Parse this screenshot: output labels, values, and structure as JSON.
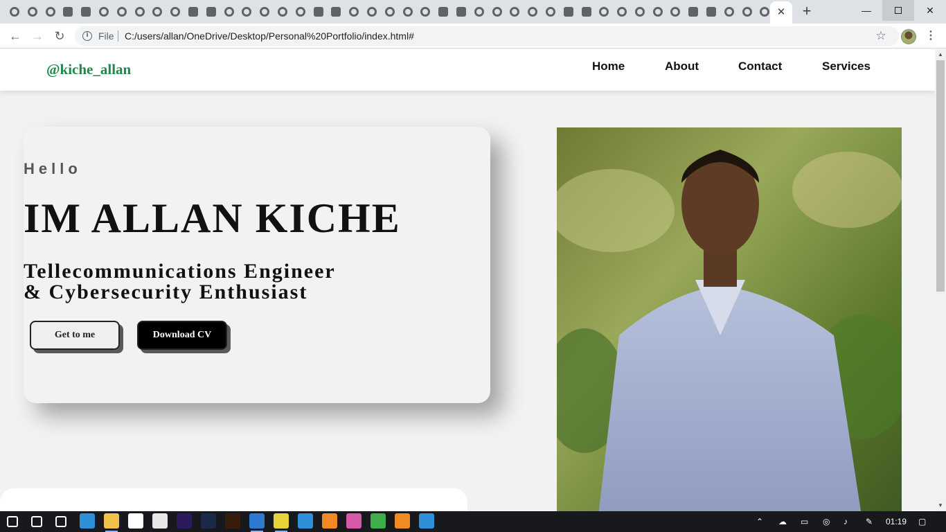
{
  "browser": {
    "tab_count": 44,
    "close_tab_glyph": "✕",
    "new_tab_glyph": "+",
    "window": {
      "minimize": "—",
      "close": "✕"
    },
    "file_label": "File",
    "url": "C:/users/allan/OneDrive/Desktop/Personal%20Portfolio/index.html#",
    "icons": {
      "back": "arrow-left-icon",
      "forward": "arrow-right-icon",
      "reload": "reload-icon",
      "info": "info-icon",
      "star": "star-icon",
      "menu": "kebab-menu-icon"
    }
  },
  "site": {
    "brand": "@kiche_allan",
    "nav": {
      "home": "Home",
      "about": "About",
      "contact": "Contact",
      "services": "Services"
    },
    "hero": {
      "greeting": "Hello",
      "name": "IM ALLAN KICHE",
      "role_line1": "Tellecommunications Engineer",
      "role_line2": "& Cybersecurity Enthusiast",
      "btn_get": "Get to me",
      "btn_cv": "Download CV"
    },
    "colors": {
      "brand": "#1f8a4c",
      "page_bg": "#f2f2f2",
      "cv_button": "#000000"
    }
  },
  "taskbar": {
    "clock": "01:19",
    "apps": [
      "windows-start-icon",
      "search-icon",
      "task-view-icon",
      "edge-icon",
      "file-explorer-icon",
      "store-icon",
      "mail-icon",
      "premiere-icon",
      "photoshop-icon",
      "illustrator-icon",
      "vscode-icon",
      "chrome-icon",
      "terminal-icon",
      "search-app-icon",
      "itunes-icon",
      "app-icon",
      "vlc-icon",
      "photos-icon"
    ]
  }
}
